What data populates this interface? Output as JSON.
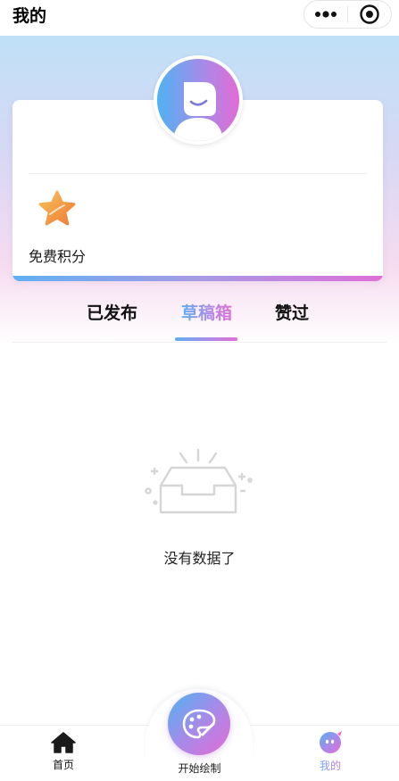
{
  "navbar": {
    "title": "我的",
    "more_icon": "more-dots-icon",
    "close_icon": "target-circle-icon"
  },
  "profile": {
    "avatar_icon": "smiley-avatar-icon",
    "points": {
      "icon": "star-icon",
      "label": "免费积分"
    }
  },
  "tabs": [
    {
      "label": "已发布",
      "active": false
    },
    {
      "label": "草稿箱",
      "active": true
    },
    {
      "label": "赞过",
      "active": false
    }
  ],
  "empty_state": {
    "icon": "empty-box-icon",
    "text": "没有数据了"
  },
  "tabbar": {
    "items": [
      {
        "label": "首页",
        "icon": "home-icon",
        "active": false
      },
      {
        "label": "开始绘制",
        "icon": "palette-icon",
        "active": false
      },
      {
        "label": "我的",
        "icon": "profile-face-icon",
        "active": true
      }
    ]
  },
  "colors": {
    "accent_blue": "#5fb0f2",
    "accent_purple": "#b487e6",
    "accent_pink": "#e06fd4",
    "star_orange": "#f29a45"
  }
}
